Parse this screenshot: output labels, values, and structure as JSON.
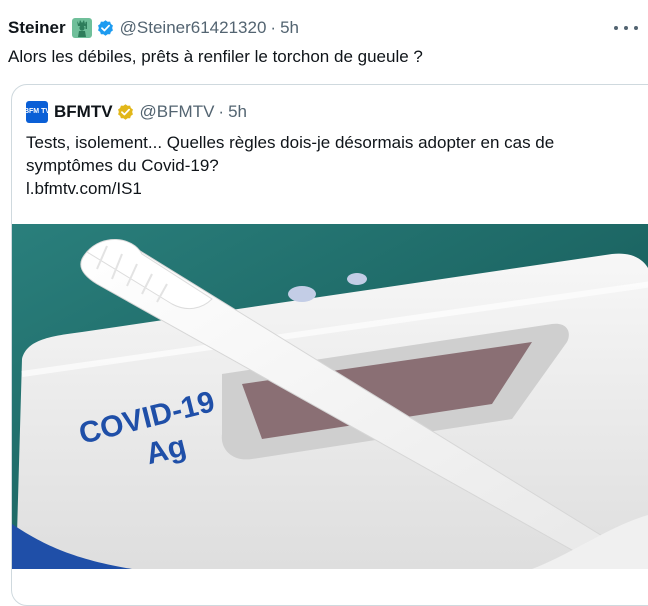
{
  "tweet": {
    "display_name": "Steiner",
    "handle": "@Steiner61421320",
    "separator": "·",
    "time": "5h",
    "text": "Alors les débiles, prêts à renfiler le torchon de gueule ?",
    "emoji_icon": "statue-of-liberty-icon",
    "verified_icon": "blue-verified-badge-icon",
    "more_icon": "more-options-icon"
  },
  "quote": {
    "display_name": "BFMTV",
    "handle": "@BFMTV",
    "separator": "·",
    "time": "5h",
    "avatar_text": "BFM TV",
    "verified_icon": "gold-verified-badge-icon",
    "text_lines": [
      "Tests, isolement... Quelles règles dois-je désormais adopter en cas de",
      "symptômes du Covid-19?"
    ],
    "link": "l.bfmtv.com/IS1",
    "media": {
      "test_label_line1": "COVID-19",
      "test_label_line2": "Ag"
    }
  },
  "colors": {
    "text": "#0f1419",
    "secondary": "#536471",
    "verified_blue": "#1d9bf0",
    "verified_gold": "#e2b719",
    "bfm_blue": "#0a5fd6",
    "test_blue": "#1f4fa8",
    "background_teal": "#1c6f6c"
  }
}
